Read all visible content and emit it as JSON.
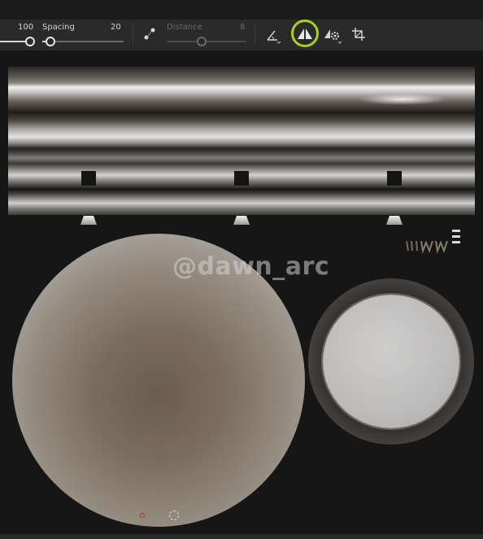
{
  "toolbar": {
    "size_value": "100",
    "spacing_label": "Spacing",
    "spacing_value": "20",
    "distance_label": "Distance",
    "distance_value": "8"
  },
  "watermark": {
    "text": "@dawn_arc"
  },
  "colors": {
    "highlight": "#a8d21c",
    "toolbar_bg": "#2a2a2a",
    "canvas_bg": "#161616",
    "marker_red": "#c0282a"
  },
  "icons": [
    "lazy-mouse-icon",
    "angle-jitter-icon",
    "symmetry-icon",
    "symmetry-options-icon",
    "transform-icon"
  ]
}
